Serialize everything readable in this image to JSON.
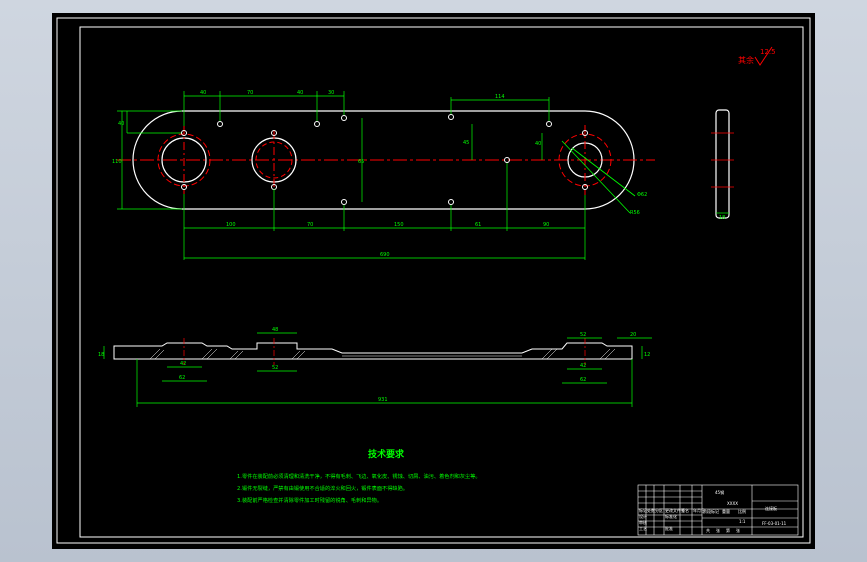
{
  "colors": {
    "bg": "#000000",
    "outline": "#ffffff",
    "dimension": "#00ff00",
    "center": "#ff0000",
    "note": "#00ff00",
    "roughness": "#ff0000"
  },
  "roughness_note": {
    "label": "其余",
    "value": "12.5"
  },
  "top_view": {
    "dims_top": [
      "40",
      "70",
      "40",
      "30",
      "114"
    ],
    "dims_bottom": [
      "100",
      "70",
      "150",
      "61",
      "90"
    ],
    "overall_length": "690",
    "dims_side": [
      "40",
      "110",
      "65",
      "45",
      "40"
    ],
    "dims_right": [
      "Φ62",
      "R56"
    ]
  },
  "side_view": {
    "dims": [
      "40",
      "18"
    ]
  },
  "front_view": {
    "dims_top": [
      "48",
      "52",
      "20"
    ],
    "dims_bottom": [
      "42",
      "62",
      "52",
      "42",
      "62",
      "931"
    ],
    "dims_side": [
      "18",
      "12"
    ]
  },
  "tech_req": {
    "title": "技术要求",
    "items": [
      "1.零件在装配前必须清理和清洗干净，不得有毛刺、飞边、氧化皮、锈蚀、切屑、油污、着色剂和灰尘等。",
      "2.锻件无裂缝，严禁有由锻使用不合适的淬火和回火，锻件表面不得缺陷。",
      "3.装配前严格检查并清除零件加工时残留的锐角、毛刺和异物。"
    ]
  },
  "title_block": {
    "material": "45钢",
    "company": "XXXX",
    "part_name": "连接板",
    "drawing_no": "FF-03-01-11",
    "labels": [
      "标记",
      "处数",
      "分区",
      "更改文件号",
      "签名",
      "年月日",
      "设计",
      "标准化",
      "审核",
      "工艺",
      "批准",
      "阶段标记",
      "重量",
      "比例",
      "共",
      "张",
      "第",
      "张"
    ],
    "scale": "1:1"
  }
}
